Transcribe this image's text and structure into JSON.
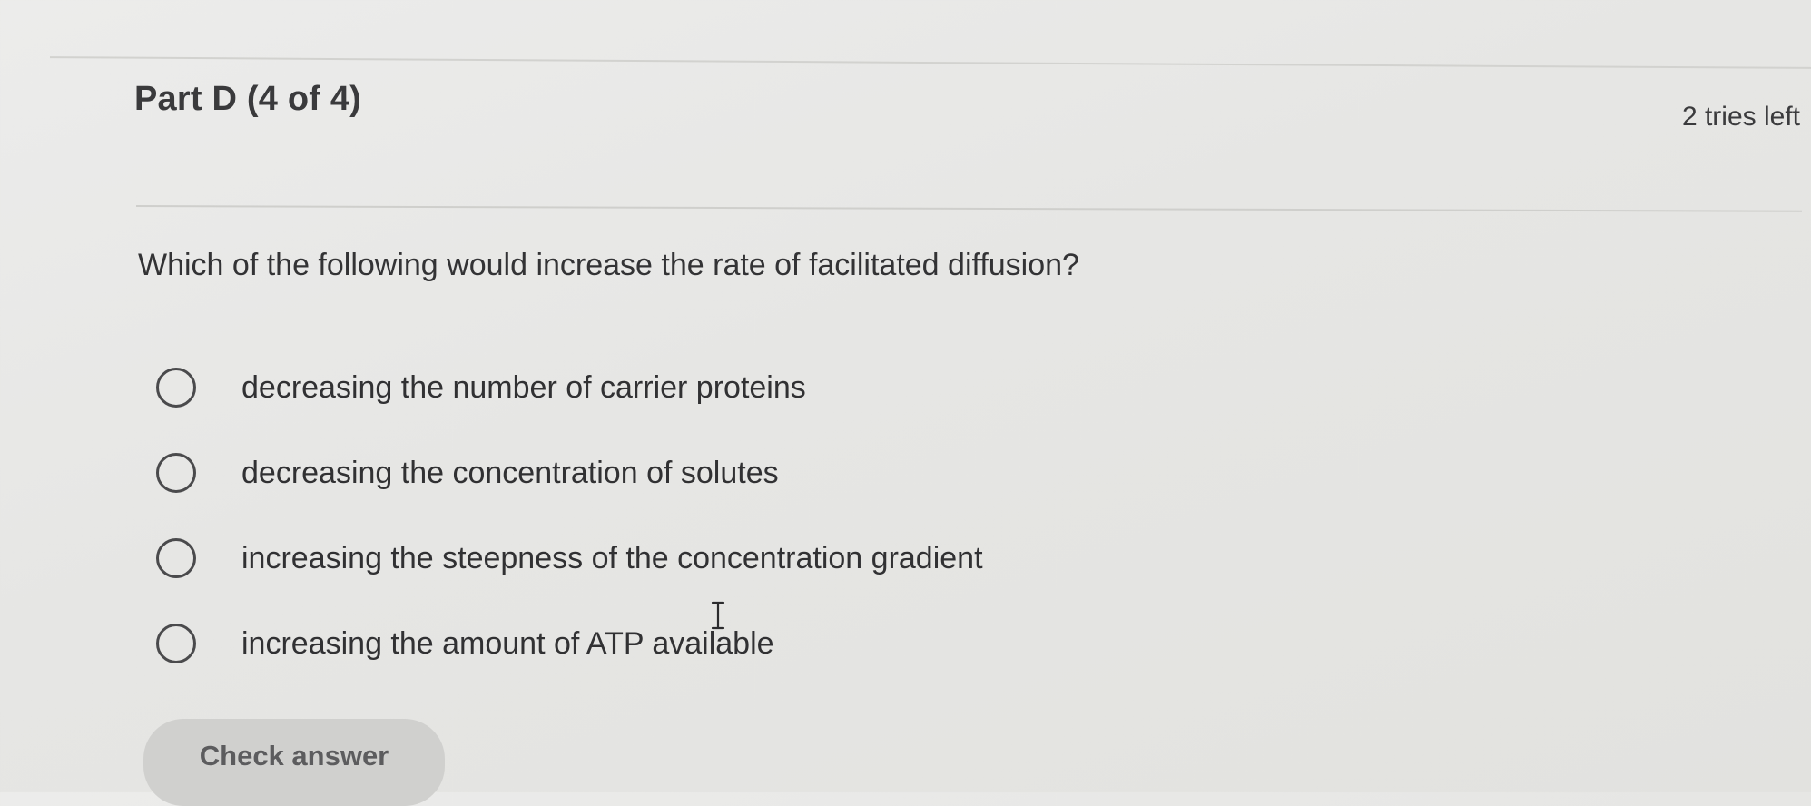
{
  "part": {
    "title": "Part D (4 of 4)",
    "tries_left": "2 tries left"
  },
  "question": {
    "text": "Which of the following would increase the rate of facilitated diffusion?"
  },
  "options": [
    {
      "label": "decreasing the number of carrier proteins",
      "selected": false
    },
    {
      "label": "decreasing the concentration of solutes",
      "selected": false
    },
    {
      "label": "increasing the steepness of the concentration gradient",
      "selected": false
    },
    {
      "label": "increasing the amount of ATP available",
      "selected": false
    }
  ],
  "actions": {
    "check_answer_label": "Check answer"
  },
  "icons": {
    "cursor": "text-cursor-icon"
  }
}
